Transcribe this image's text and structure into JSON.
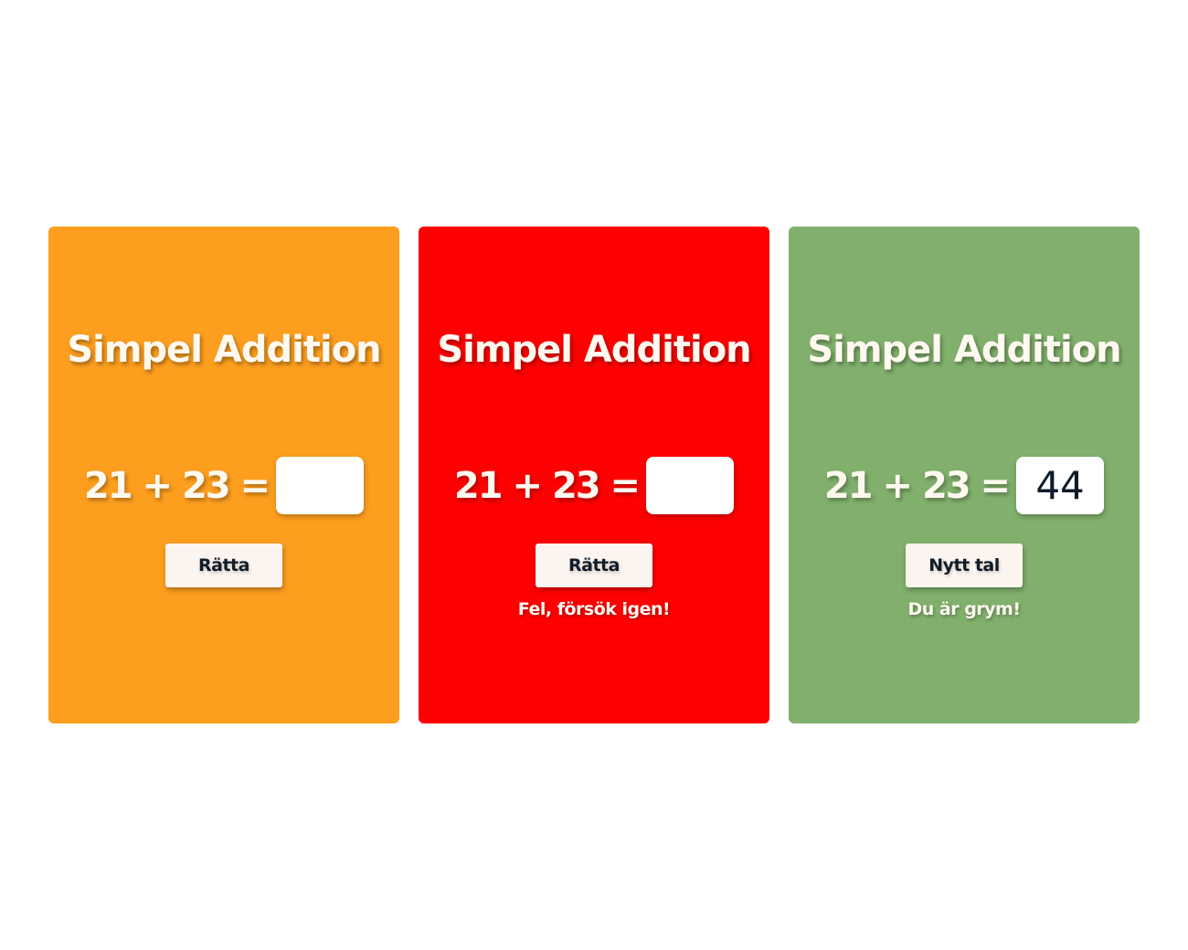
{
  "colors": {
    "card_neutral": "#fd9e1e",
    "card_wrong": "#fe0000",
    "card_correct": "#81b06c",
    "button_bg": "#fcf4ee",
    "text_light": "#fff9f0",
    "text_dark": "#111c2a"
  },
  "cards": [
    {
      "state": "neutral",
      "title": "Simpel Addition",
      "equation": "21 + 23 =",
      "answer_value": "",
      "button_label": "Rätta",
      "feedback": ""
    },
    {
      "state": "wrong",
      "title": "Simpel Addition",
      "equation": "21 + 23 =",
      "answer_value": "",
      "button_label": "Rätta",
      "feedback": "Fel, försök igen!"
    },
    {
      "state": "correct",
      "title": "Simpel Addition",
      "equation": "21 + 23 =",
      "answer_value": "44",
      "button_label": "Nytt tal",
      "feedback": "Du är grym!"
    }
  ]
}
